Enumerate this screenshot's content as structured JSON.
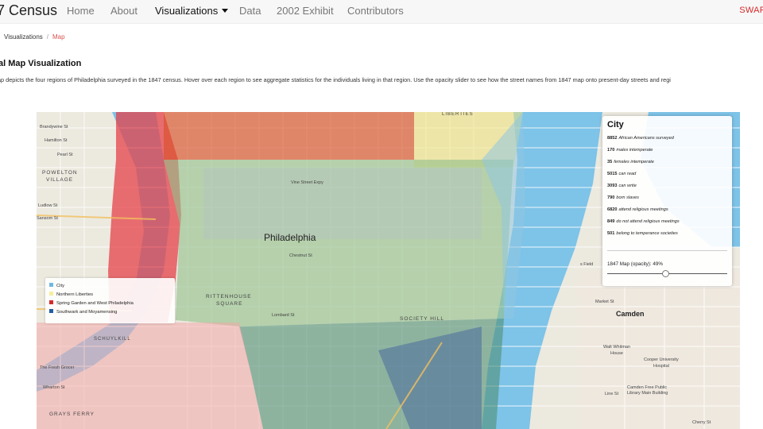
{
  "navbar": {
    "brand": "7 Census",
    "items": [
      {
        "label": "Home"
      },
      {
        "label": "About"
      },
      {
        "label": "Visualizations"
      },
      {
        "label": "Data"
      },
      {
        "label": "2002 Exhibit"
      },
      {
        "label": "Contributors"
      }
    ],
    "right_label": "SWAR"
  },
  "breadcrumb": {
    "parent": "Visualizations",
    "separator": "/",
    "current": "Map"
  },
  "page": {
    "title": "al Map Visualization",
    "description": "ap depicts the four regions of Philadelphia surveyed in the 1847 census. Hover over each region to see aggregate statistics for the individuals living in that region. Use the opacity slider to see how the street names from 1847 map onto present-day streets and regi"
  },
  "info_panel": {
    "title": "City",
    "stats": [
      {
        "value": "8852",
        "label": "African Americans surveyed"
      },
      {
        "value": "170",
        "label": "males intemperate"
      },
      {
        "value": "35",
        "label": "females intemperate"
      },
      {
        "value": "5015",
        "label": "can read"
      },
      {
        "value": "3093",
        "label": "can write"
      },
      {
        "value": "790",
        "label": "born slaves"
      },
      {
        "value": "6820",
        "label": "attend religious meetings"
      },
      {
        "value": "849",
        "label": "do not attend religious meetings"
      },
      {
        "value": "501",
        "label": "belong to temperance societies"
      }
    ],
    "slider_label": "1847 Map (opacity): 49%",
    "slider_value": 0.49
  },
  "legend": {
    "items": [
      {
        "label": "City",
        "color": "#6fb8e3"
      },
      {
        "label": "Northern Liberties",
        "color": "#f7ee9a"
      },
      {
        "label": "Spring Garden and West Philadelphia",
        "color": "#d62a2a"
      },
      {
        "label": "Southwark and Moyamensing",
        "color": "#1f5ea0"
      }
    ]
  },
  "map_labels": {
    "philadelphia": "Philadelphia",
    "camden": "Camden",
    "powelton": "POWELTON",
    "village": "VILLAGE",
    "schuylkill": "SCHUYLKILL",
    "grays_ferry": "GRAYS FERRY",
    "rittenhouse": "RITTENHOUSE",
    "square": "SQUARE",
    "society_hill": "SOCIETY HILL",
    "liberties": "LIBERTIES",
    "brandywine": "Brandywine St",
    "hamilton": "Hamilton St",
    "pearl": "Pearl St",
    "ludlow": "Ludlow St",
    "sansom": "Sansom St",
    "vine": "Vine Street Expy",
    "chestnut": "Chestnut St",
    "lombard": "Lombard St",
    "market": "Market St",
    "fresh_grocer": "The Fresh Grocer",
    "wharton": "Wharton St",
    "walt_whitman": "Walt Whitman",
    "house": "House",
    "cooper": "Cooper University",
    "hospital": "Hospital",
    "library": "Camden Free Public Library Main Building",
    "line_st": "Line St",
    "cherry": "Cherry St",
    "field": "s Field"
  }
}
